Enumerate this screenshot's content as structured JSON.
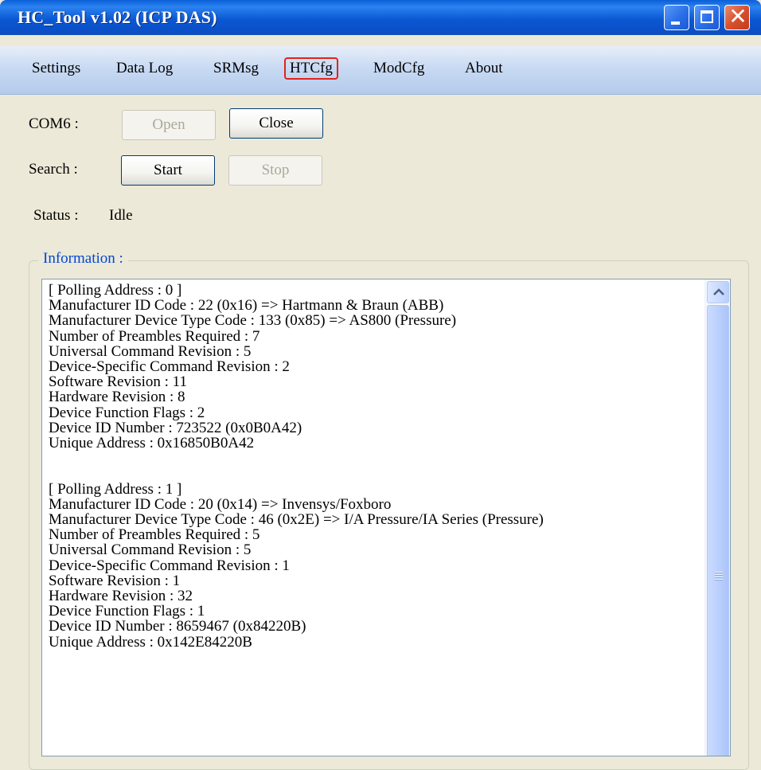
{
  "window": {
    "title": "HC_Tool v1.02  (ICP DAS)",
    "controls": {
      "minimize_icon": "minimize-icon",
      "maximize_icon": "maximize-icon",
      "close_icon": "close-icon",
      "close_glyph": "✕"
    }
  },
  "menu": {
    "items": [
      "Settings",
      "Data Log",
      "SRMsg",
      "HTCfg",
      "ModCfg",
      "About"
    ],
    "highlighted": "HTCfg",
    "highlight_color": "#E2231A"
  },
  "com": {
    "label": "COM6 :",
    "open_label": "Open",
    "close_label": "Close"
  },
  "search": {
    "label": "Search :",
    "start_label": "Start",
    "stop_label": "Stop"
  },
  "status": {
    "label": "Status :",
    "value": "Idle"
  },
  "information": {
    "title": "Information :",
    "text": "[ Polling Address : 0 ]\nManufacturer ID Code : 22 (0x16) => Hartmann & Braun (ABB)\nManufacturer Device Type Code : 133 (0x85) => AS800 (Pressure)\nNumber of Preambles Required : 7\nUniversal Command Revision : 5\nDevice-Specific Command Revision : 2\nSoftware Revision : 11\nHardware Revision : 8\nDevice Function Flags : 2\nDevice ID Number : 723522 (0x0B0A42)\nUnique Address : 0x16850B0A42\n\n\n[ Polling Address : 1 ]\nManufacturer ID Code : 20 (0x14) => Invensys/Foxboro\nManufacturer Device Type Code : 46 (0x2E) => I/A Pressure/IA Series (Pressure)\nNumber of Preambles Required : 5\nUniversal Command Revision : 5\nDevice-Specific Command Revision : 1\nSoftware Revision : 1\nHardware Revision : 32\nDevice Function Flags : 1\nDevice ID Number : 8659467 (0x84220B)\nUnique Address : 0x142E84220B"
  },
  "colors": {
    "title_bar": "#0A5FD8",
    "window_bg": "#ECE9D8",
    "group_title": "#0046D5"
  }
}
